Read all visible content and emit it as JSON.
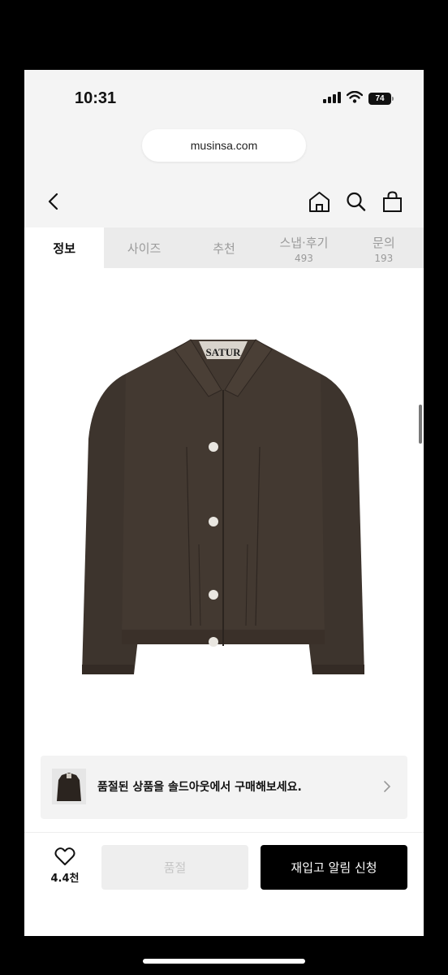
{
  "status_bar": {
    "time": "10:31",
    "battery": "74"
  },
  "browser": {
    "url": "musinsa.com"
  },
  "nav": {
    "icons": [
      "back-icon",
      "home-icon",
      "search-icon",
      "shopping-bag-icon"
    ]
  },
  "tabs": [
    {
      "label": "정보",
      "count": ""
    },
    {
      "label": "사이즈",
      "count": ""
    },
    {
      "label": "추천",
      "count": ""
    },
    {
      "label": "스냅·후기",
      "count": "493"
    },
    {
      "label": "문의",
      "count": "193"
    }
  ],
  "product": {
    "collar_label_text": "SATUR",
    "color": "#3d342d"
  },
  "banner": {
    "text": "품절된 상품을 솔드아웃에서 구매해보세요."
  },
  "actions": {
    "like_count": "4.4천",
    "soldout_label": "품절",
    "restock_label": "재입고 알림 신청"
  }
}
